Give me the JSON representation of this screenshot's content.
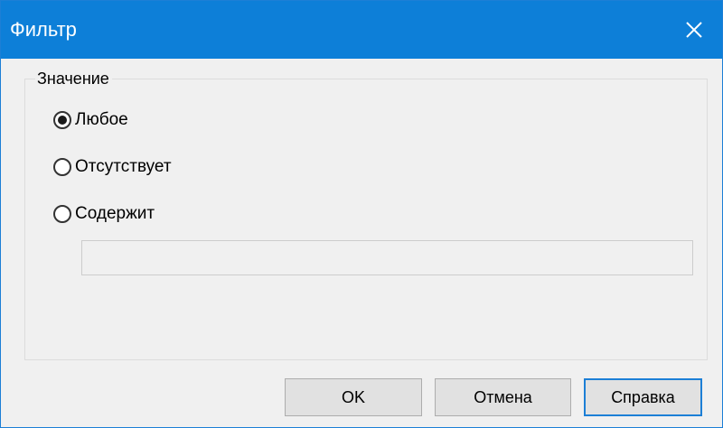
{
  "window": {
    "title": "Фильтр",
    "accent_color": "#0d7fd8",
    "close_icon": "close-icon"
  },
  "group": {
    "label": "Значение",
    "options": [
      {
        "label": "Любое",
        "checked": true
      },
      {
        "label": "Отсутствует",
        "checked": false
      },
      {
        "label": "Содержит",
        "checked": false
      }
    ],
    "contains_input": {
      "value": "",
      "placeholder": ""
    }
  },
  "buttons": {
    "ok": "OK",
    "cancel": "Отмена",
    "help": "Справка"
  }
}
